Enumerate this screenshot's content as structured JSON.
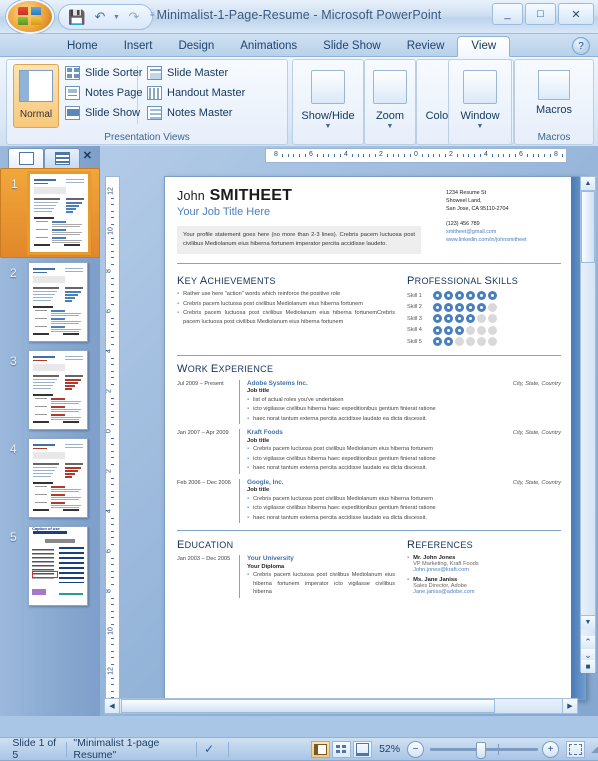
{
  "window": {
    "title": "Minimalist-1-Page-Resume - Microsoft PowerPoint",
    "minimize": "_",
    "maximize": "□",
    "close": "✕",
    "office_orb": "office-orb",
    "qat": {
      "save": "💾",
      "undo": "↶",
      "redo": "↷",
      "dropdown": "▼",
      "more": "≡"
    }
  },
  "tabs": [
    {
      "label": "Home",
      "active": false
    },
    {
      "label": "Insert",
      "active": false
    },
    {
      "label": "Design",
      "active": false
    },
    {
      "label": "Animations",
      "active": false
    },
    {
      "label": "Slide Show",
      "active": false
    },
    {
      "label": "Review",
      "active": false
    },
    {
      "label": "View",
      "active": true
    }
  ],
  "help_label": "?",
  "ribbon": {
    "groups": [
      {
        "label": "Presentation Views"
      },
      {
        "label": "Macros"
      }
    ],
    "normal_label": "Normal",
    "view_items_col1": [
      {
        "label": "Slide Sorter",
        "icon": "slide-sorter-icon"
      },
      {
        "label": "Notes Page",
        "icon": "notes-page-icon"
      },
      {
        "label": "Slide Show",
        "icon": "slide-show-icon"
      }
    ],
    "view_items_col2": [
      {
        "label": "Slide Master",
        "icon": "slide-master-icon"
      },
      {
        "label": "Handout Master",
        "icon": "handout-master-icon"
      },
      {
        "label": "Notes Master",
        "icon": "notes-master-icon"
      }
    ],
    "big_buttons": [
      {
        "label": "Show/Hide",
        "icon": "show-hide-icon",
        "caret": "▼"
      },
      {
        "label": "Zoom",
        "icon": "zoom-icon",
        "caret": "▼"
      },
      {
        "label": "Color/Grayscale",
        "icon": "color-grayscale-icon",
        "caret": "▼"
      },
      {
        "label": "Window",
        "icon": "window-icon",
        "caret": "▼"
      },
      {
        "label": "Macros",
        "icon": "macros-icon",
        "caret": ""
      }
    ]
  },
  "panel": {
    "tab_slides": "slides-tab",
    "tab_outline": "outline-tab",
    "close": "✕",
    "thumbnails": [
      {
        "number": "1",
        "selected": true
      },
      {
        "number": "2",
        "selected": false
      },
      {
        "number": "3",
        "selected": false
      },
      {
        "number": "4",
        "selected": false
      },
      {
        "number": "5",
        "selected": false,
        "title": "Caption of use"
      }
    ]
  },
  "rulers": {
    "horizontal": [
      "8",
      "6",
      "4",
      "2",
      "0",
      "2",
      "4",
      "6",
      "8"
    ],
    "vertical": [
      "12",
      "10",
      "8",
      "6",
      "4",
      "2",
      "0",
      "2",
      "4",
      "6",
      "8",
      "10",
      "12"
    ]
  },
  "slide": {
    "name": "JOHN SMITHEET",
    "name_first": "John",
    "name_last": "SMITHEET",
    "job_title": "Your Job Title Here",
    "contact": {
      "address1": "1234 Resume St",
      "address2": "Showeel Land,",
      "address3": "San Jose, CA 95110-2704",
      "phone": "(123) 456 789",
      "email": "smitheet@gmail.com",
      "website": "www.linkedin.com/in/johnsmitheet"
    },
    "profile": "Your profile statement goes here (no more than 2-3 lines). Crebris pacem luctuosa post civilibus Mediolanum eius hiberna fortunem imperator percita accidisse laudeto.",
    "sections": {
      "key_achievements": {
        "title": "Key Achievements",
        "bullets": [
          "Rather use here \"action\" words which reinforce the positive role",
          "Crebris pacem luctuosa post civilibus Mediolanum eius hiberna fortunem",
          "Crebris pacem luctuosa post civilibus Mediolanum eius hiberna fortunemCrebris pacem luctuosa post civilibus Mediolanum eius hiberna fortunem"
        ]
      },
      "professional_skills": {
        "title": "Professional Skills",
        "max_dots": 6,
        "skills": [
          {
            "label": "Skill 1",
            "rating": 6
          },
          {
            "label": "Skill 2",
            "rating": 5
          },
          {
            "label": "Skill 3",
            "rating": 4
          },
          {
            "label": "Skill 4",
            "rating": 3
          },
          {
            "label": "Skill 5",
            "rating": 2
          }
        ]
      },
      "work_experience": {
        "title": "Work Experience",
        "entries": [
          {
            "dates": "Jul 2009 – Present",
            "company": "Adobe Systems Inc.",
            "location": "City, State, Country",
            "job_title": "Job title",
            "bullets": [
              "list of actual roles you've undertaken",
              "icto vigilasse civilibus hiberna haec expeditionibus gentium finierat ratione",
              "haec norat tantum externa percita accidisse laudato ea dicta discessit."
            ]
          },
          {
            "dates": "Jan 2007 – Apr 2009",
            "company": "Kraft Foods",
            "location": "City, State, Country",
            "job_title": "Job title",
            "bullets": [
              "Crebris pacem luctuosa post civilibus Mediolanum eius hiberna fortunem",
              "icto vigilasse civilibus hiberna haec expeditionibus gentium finierat ratione",
              "haec norat tantum externa percita accidisse laudato ea dicta discessit."
            ]
          },
          {
            "dates": "Feb 2006 – Dec 2006",
            "company": "Google, Inc.",
            "location": "City, State, Country",
            "job_title": "Job title",
            "bullets": [
              "Crebris pacem luctuosa post civilibus Mediolanum eius hiberna fortunem",
              "icto vigilasse civilibus hiberna haec expeditionibus gentium finierat ratione",
              "haec norat tantum externa percita accidisse laudato ea dicta discessit."
            ]
          }
        ]
      },
      "education": {
        "title": "Education",
        "entries": [
          {
            "dates": "Jan 2003 – Dec 2005",
            "school": "Your University",
            "diploma": "Your Diploma",
            "bullets": [
              "Crebris pacem luctuosa post civilibus Mediolanum eius hiberna fortunem imperator icto vigilasse civilibus hiberna"
            ]
          }
        ]
      },
      "references": {
        "title": "References",
        "items": [
          {
            "name": "Mr. John Jones",
            "role": "VP Marketing, Kraft Foods",
            "email": "John.jones@kraft.com"
          },
          {
            "name": "Ms. Jane Janiss",
            "role": "Sales Director, Adobe",
            "email": "Jane.janiss@adobe.com"
          }
        ]
      }
    }
  },
  "status": {
    "slide_counter": "Slide 1 of 5",
    "theme": "\"Minimalist 1-page Resume\"",
    "spellcheck_icon": "spellcheck-icon",
    "view_normal": "normal-view-icon",
    "view_sorter": "slide-sorter-view-icon",
    "view_show": "slide-show-view-icon",
    "zoom": "52%",
    "zoom_out": "−",
    "zoom_in": "+",
    "fit_icon": "fit-slide-icon"
  },
  "scroll": {
    "up": "▲",
    "down": "▼",
    "left": "◀",
    "right": "▶",
    "prev_slide": "⌃",
    "next_slide": "⌄"
  },
  "colors": {
    "accent_blue": "#4a7fbd",
    "dark_navy": "#15335c",
    "dot_off": "#d9d9d9",
    "highlight_orange": "#e79b2e"
  }
}
